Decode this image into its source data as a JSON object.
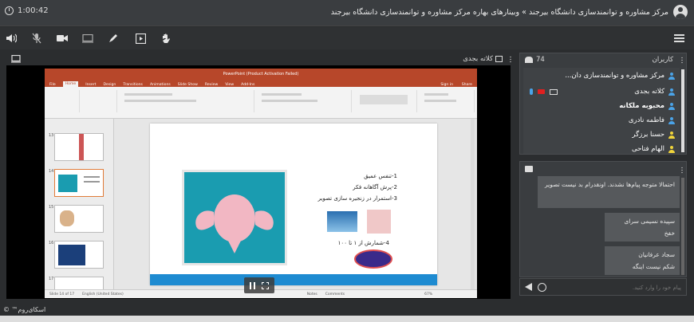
{
  "header": {
    "timer": "1:00:42",
    "title": "مرکز مشاوره و توانمندسازی دانشگاه بیرجند » وبینارهای بهاره مرکز مشاوره و توانمندسازی دانشگاه بیرجند"
  },
  "toolbar": {
    "icons": [
      "speaker-icon",
      "mic-muted-icon",
      "camera-icon",
      "screen-share-icon",
      "pen-icon",
      "play-media-icon",
      "raise-hand-icon"
    ]
  },
  "stage": {
    "panel_title": "کلاته بجدی",
    "powerpoint": {
      "title": "PowerPoint (Product Activation Failed)",
      "tabs": [
        "File",
        "Home",
        "Insert",
        "Design",
        "Transitions",
        "Animations",
        "Slide Show",
        "Review",
        "View",
        "Add-Ins"
      ],
      "active_tab": "Home",
      "share": "Share",
      "signin": "Sign in",
      "thumb_numbers": [
        "13",
        "14",
        "15",
        "16",
        "17"
      ],
      "status": [
        "Slide 14 of 17",
        "English (United States)",
        "Notes",
        "Comments"
      ],
      "zoom": "67%"
    },
    "slide": {
      "lines": [
        "1-تنفس عمیق",
        "2-پرش آگاهانه فکر",
        "3-استمرار در زنجیره سازی تصویر",
        "4-شمارش از ۱ تا ۱۰۰"
      ]
    }
  },
  "participants": {
    "title": "کاربران",
    "count": "74",
    "users": [
      {
        "name": "مرکز مشاوره و توانمندسازی دان...",
        "color": "#4aa3e8",
        "bold": false
      },
      {
        "name": "کلاته بجدی",
        "color": "#4aa3e8",
        "bold": false
      },
      {
        "name": "محبوبه ملکانه",
        "color": "#4aa3e8",
        "bold": true
      },
      {
        "name": "فاطمه نادری",
        "color": "#4aa3e8",
        "bold": false
      },
      {
        "name": "حسنا برزگر",
        "color": "#f0d43a",
        "bold": false
      },
      {
        "name": "الهام فتاحی",
        "color": "#f0d43a",
        "bold": false
      }
    ]
  },
  "chat": {
    "messages": [
      {
        "text": "احتمالا متوجه پیام‌ها نشدند. اونقدرام بد نیست تصویر"
      },
      {
        "author": "سپیده نسیمی سرای",
        "text": "خفخ"
      },
      {
        "author": "سجاد عرفانیان",
        "text": "شکم نیست اینگه"
      }
    ],
    "placeholder": "پیام خود را وارد کنید."
  },
  "footer": {
    "brand": "اسکای‌روم™ ©"
  }
}
